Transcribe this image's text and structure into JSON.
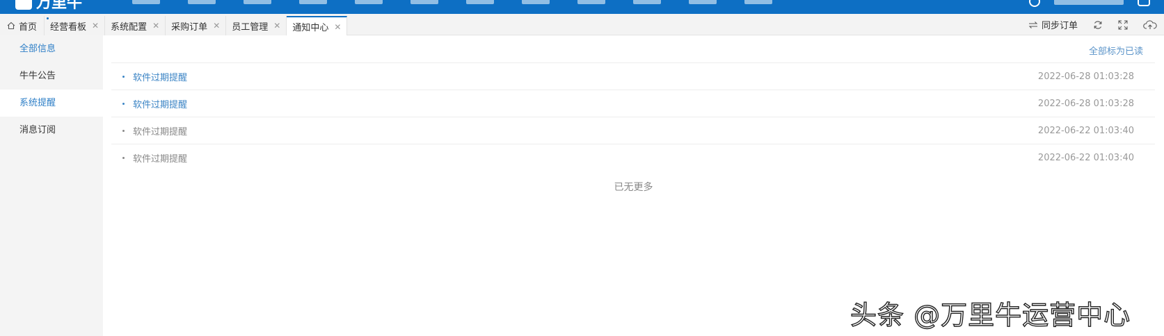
{
  "header": {
    "logo_text": "万里牛",
    "nav_count": 12
  },
  "tabs": [
    {
      "label": "首页",
      "icon": "home-icon",
      "closable": false,
      "active": false
    },
    {
      "label": "经营看板",
      "closable": true,
      "active": false
    },
    {
      "label": "系统配置",
      "closable": true,
      "active": false
    },
    {
      "label": "采购订单",
      "closable": true,
      "active": false
    },
    {
      "label": "员工管理",
      "closable": true,
      "active": false
    },
    {
      "label": "通知中心",
      "closable": true,
      "active": true
    }
  ],
  "toolbar": {
    "sync_label": "同步订单",
    "icons": [
      "sync-icon",
      "refresh-icon",
      "fullscreen-icon",
      "cloud-upload-icon"
    ]
  },
  "sidebar": {
    "items": [
      {
        "label": "全部信息"
      },
      {
        "label": "牛牛公告"
      },
      {
        "label": "系统提醒"
      },
      {
        "label": "消息订阅"
      }
    ],
    "active_index": 2
  },
  "main": {
    "mark_all_read": "全部标为已读",
    "notifications": [
      {
        "title": "软件过期提醒",
        "time": "2022-06-28 01:03:28",
        "unread": true
      },
      {
        "title": "软件过期提醒",
        "time": "2022-06-28 01:03:28",
        "unread": true
      },
      {
        "title": "软件过期提醒",
        "time": "2022-06-22 01:03:40",
        "unread": false
      },
      {
        "title": "软件过期提醒",
        "time": "2022-06-22 01:03:40",
        "unread": false
      }
    ],
    "no_more": "已无更多"
  },
  "watermark": "头条 @万里牛运营中心",
  "colors": {
    "brand": "#0d6fc4",
    "link": "#3b84c5",
    "muted": "#888888"
  }
}
